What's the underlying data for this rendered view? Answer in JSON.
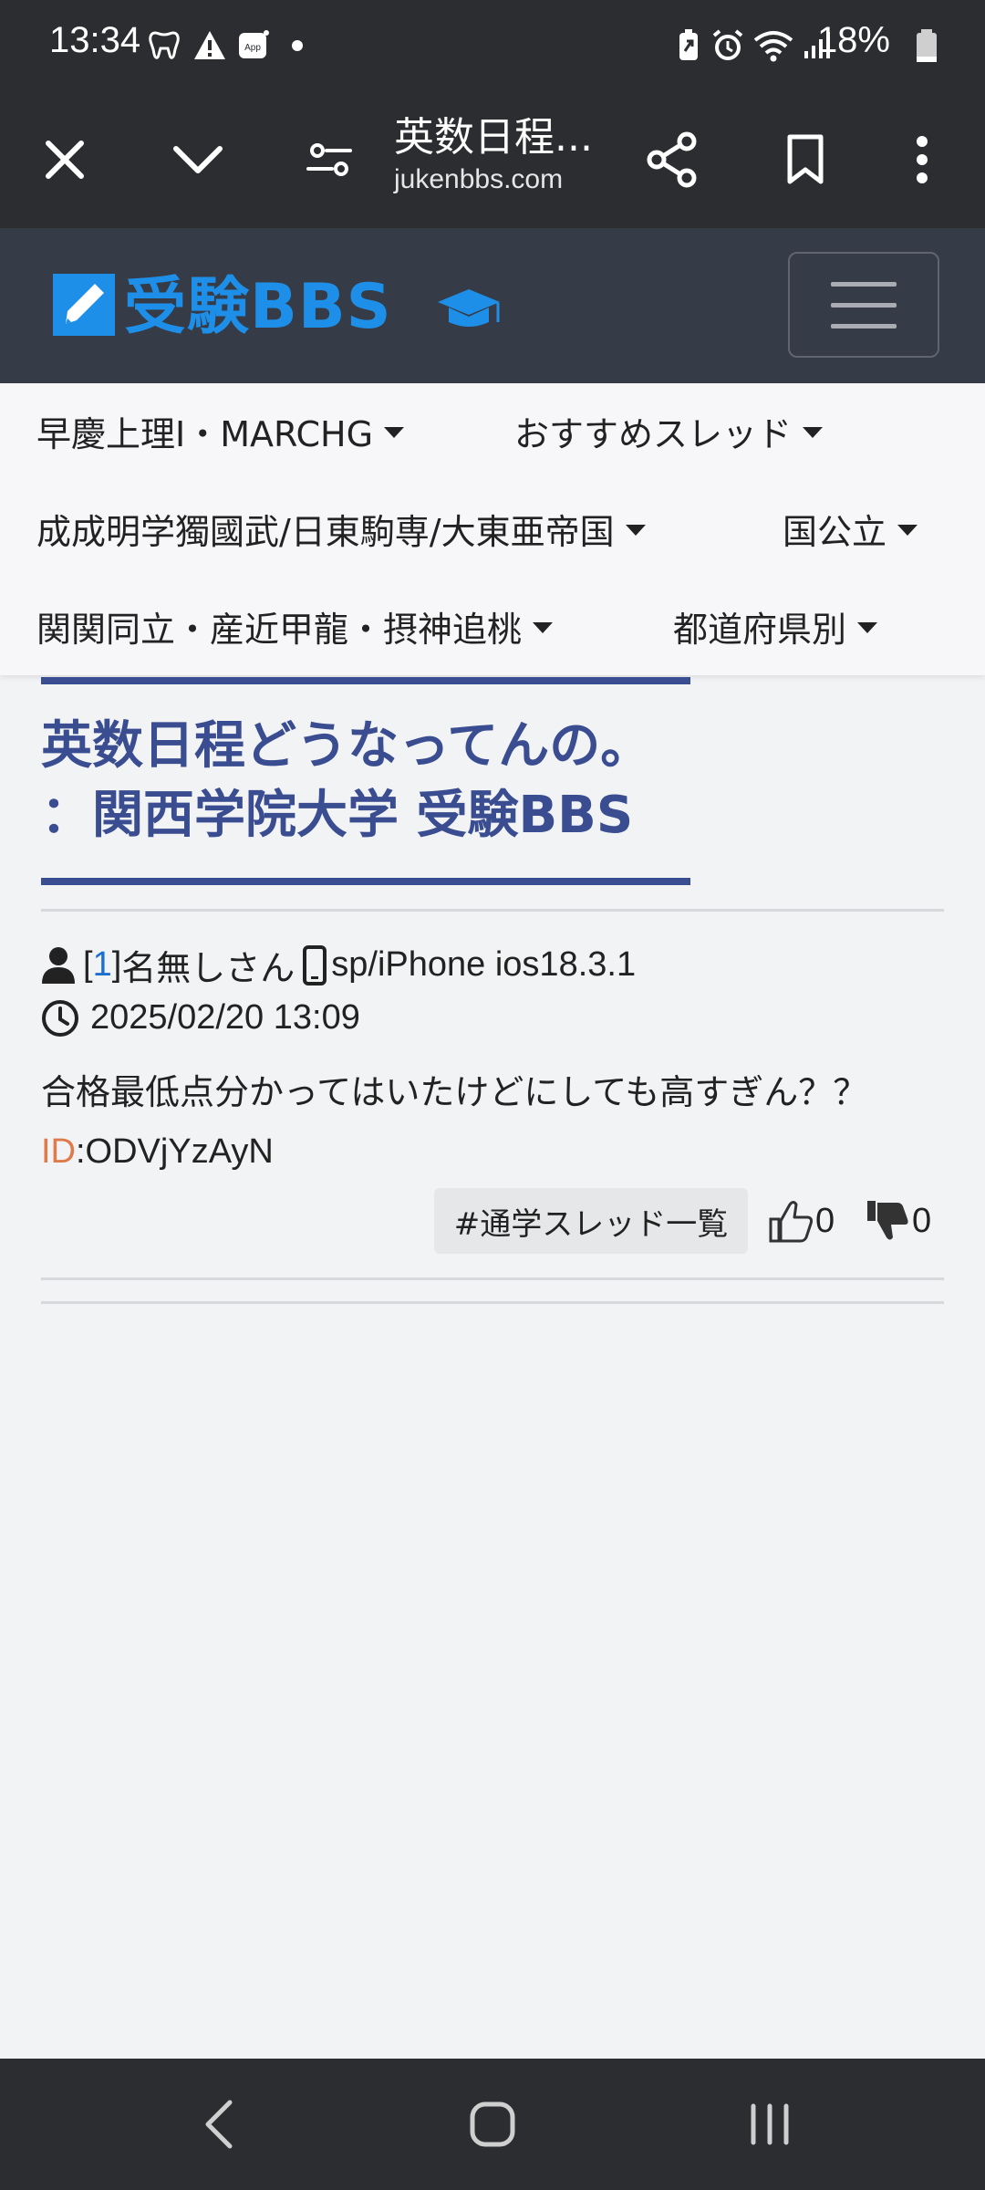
{
  "status_bar": {
    "time": "13:34",
    "battery": "18%",
    "icons": [
      "tooth-icon",
      "warning-icon",
      "app-icon",
      "dot-icon",
      "battery-saver-icon",
      "alarm-icon",
      "wifi-icon",
      "signal-icon",
      "battery-icon"
    ]
  },
  "browser": {
    "title": "英数日程...",
    "domain": "jukenbbs.com",
    "icons": [
      "close-icon",
      "chevron-down-icon",
      "tune-icon",
      "share-icon",
      "bookmark-icon",
      "more-vert-icon"
    ]
  },
  "site": {
    "logo_text": "受験BBS",
    "menu_icon": "hamburger-icon"
  },
  "nav": {
    "items": [
      {
        "label": "早慶上理I・MARCHG"
      },
      {
        "label": "おすすめスレッド"
      },
      {
        "label": "成成明学獨國武/日東駒専/大東亜帝国"
      },
      {
        "label": "国公立"
      },
      {
        "label": "関関同立・産近甲龍・摂神追桃"
      },
      {
        "label": "都道府県別"
      }
    ]
  },
  "thread": {
    "title_line1": "英数日程どうなってんの。",
    "title_line2": "：関西学院大学 受験BBS"
  },
  "post": {
    "number_open": "[",
    "number": "1",
    "number_close": "]",
    "author": "名無しさん",
    "device": "sp/iPhone ios18.3.1",
    "datetime": "2025/02/20 13:09",
    "body": "合格最低点分かってはいたけどにしても高すぎん？？",
    "id_label": "ID",
    "id_value": ":ODVjYzAyN",
    "tag": "#通学スレッド一覧",
    "likes": "0",
    "dislikes": "0"
  },
  "colors": {
    "accent": "#3a4d91",
    "id_label": "#e07a4a",
    "link": "#1a6fd0",
    "logo_blue": "#1e8fe8"
  }
}
